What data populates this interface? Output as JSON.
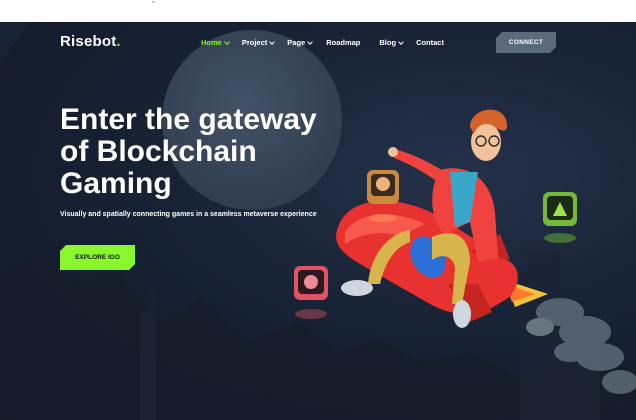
{
  "brand": {
    "name": "Risebot",
    "dot": "."
  },
  "nav": {
    "items": [
      {
        "label": "Home",
        "dropdown": true,
        "active": true
      },
      {
        "label": "Project",
        "dropdown": true,
        "active": false
      },
      {
        "label": "Page",
        "dropdown": true,
        "active": false
      },
      {
        "label": "Roadmap",
        "dropdown": false,
        "active": false
      },
      {
        "label": "Blog",
        "dropdown": true,
        "active": false
      },
      {
        "label": "Contact",
        "dropdown": false,
        "active": false
      }
    ],
    "connect_label": "CONNECT"
  },
  "hero": {
    "title_lines": [
      "Enter the gateway",
      "of Blockchain",
      "Gaming"
    ],
    "subtitle": "Visually and spatially connecting games in a seamless metaverse experience",
    "cta_label": "EXPLORE IGO"
  },
  "colors": {
    "accent": "#89f72b",
    "background": "#161f2e",
    "connect_button": "#5b6b7c",
    "rocket": "#e8322f"
  },
  "icons": [
    "chevron-down-icon"
  ]
}
